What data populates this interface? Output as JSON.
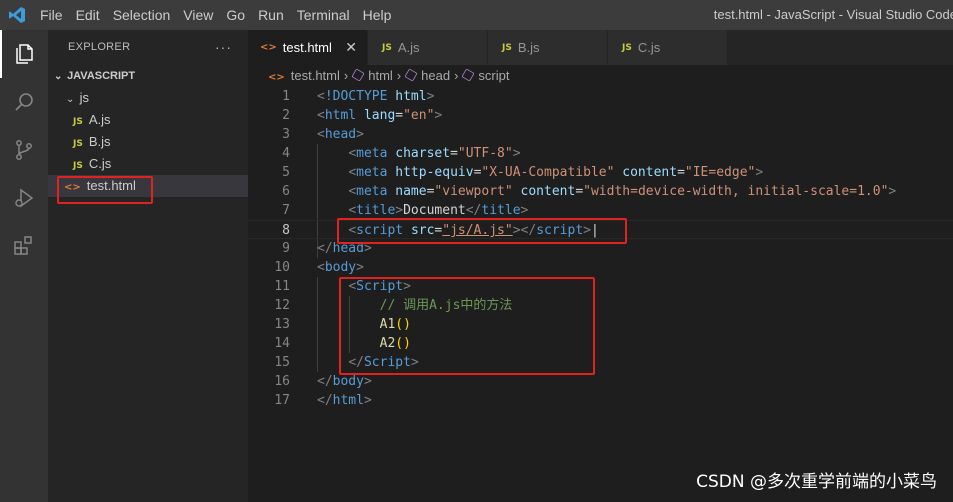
{
  "titlebar": {
    "menu": [
      "File",
      "Edit",
      "Selection",
      "View",
      "Go",
      "Run",
      "Terminal",
      "Help"
    ],
    "window_title": "test.html - JavaScript - Visual Studio Code"
  },
  "activitybar": {
    "icons": [
      "explorer-icon",
      "search-icon",
      "source-control-icon",
      "run-debug-icon",
      "extensions-icon"
    ]
  },
  "sidebar": {
    "title": "EXPLORER",
    "more": "···",
    "section": "JAVASCRIPT",
    "folder": "js",
    "files": [
      {
        "badge": "JS",
        "name": "A.js"
      },
      {
        "badge": "JS",
        "name": "B.js"
      },
      {
        "badge": "JS",
        "name": "C.js"
      }
    ],
    "html_file": {
      "badge": "<>",
      "name": "test.html"
    }
  },
  "tabs": [
    {
      "badge": "<>",
      "label": "test.html",
      "close": "✕"
    },
    {
      "badge": "JS",
      "label": "A.js"
    },
    {
      "badge": "JS",
      "label": "B.js"
    },
    {
      "badge": "JS",
      "label": "C.js"
    }
  ],
  "breadcrumb": [
    "test.html",
    "html",
    "head",
    "script"
  ],
  "editor": {
    "line_numbers": [
      "1",
      "2",
      "3",
      "4",
      "5",
      "6",
      "7",
      "8",
      "9",
      "10",
      "11",
      "12",
      "13",
      "14",
      "15",
      "16",
      "17"
    ],
    "current_line": "8",
    "comment_text": "// 调用A.js中的方法",
    "call_a1": "A1",
    "call_a2": "A2"
  },
  "watermark": "CSDN @多次重学前端的小菜鸟",
  "colors": {
    "highlight_box": "#e0231f",
    "js_badge": "#cbcb41",
    "html_badge": "#e37933"
  }
}
